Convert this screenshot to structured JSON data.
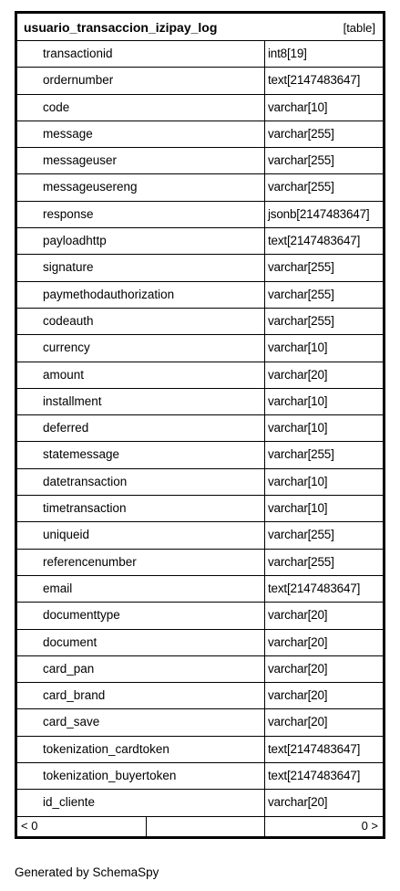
{
  "table": {
    "name": "usuario_transaccion_izipay_log",
    "kind": "[table]",
    "columns": [
      {
        "name": "transactionid",
        "type": "int8[19]"
      },
      {
        "name": "ordernumber",
        "type": "text[2147483647]"
      },
      {
        "name": "code",
        "type": "varchar[10]"
      },
      {
        "name": "message",
        "type": "varchar[255]"
      },
      {
        "name": "messageuser",
        "type": "varchar[255]"
      },
      {
        "name": "messageusereng",
        "type": "varchar[255]"
      },
      {
        "name": "response",
        "type": "jsonb[2147483647]"
      },
      {
        "name": "payloadhttp",
        "type": "text[2147483647]"
      },
      {
        "name": "signature",
        "type": "varchar[255]"
      },
      {
        "name": "paymethodauthorization",
        "type": "varchar[255]"
      },
      {
        "name": "codeauth",
        "type": "varchar[255]"
      },
      {
        "name": "currency",
        "type": "varchar[10]"
      },
      {
        "name": "amount",
        "type": "varchar[20]"
      },
      {
        "name": "installment",
        "type": "varchar[10]"
      },
      {
        "name": "deferred",
        "type": "varchar[10]"
      },
      {
        "name": "statemessage",
        "type": "varchar[255]"
      },
      {
        "name": "datetransaction",
        "type": "varchar[10]"
      },
      {
        "name": "timetransaction",
        "type": "varchar[10]"
      },
      {
        "name": "uniqueid",
        "type": "varchar[255]"
      },
      {
        "name": "referencenumber",
        "type": "varchar[255]"
      },
      {
        "name": "email",
        "type": "text[2147483647]"
      },
      {
        "name": "documenttype",
        "type": "varchar[20]"
      },
      {
        "name": "document",
        "type": "varchar[20]"
      },
      {
        "name": "card_pan",
        "type": "varchar[20]"
      },
      {
        "name": "card_brand",
        "type": "varchar[20]"
      },
      {
        "name": "card_save",
        "type": "varchar[20]"
      },
      {
        "name": "tokenization_cardtoken",
        "type": "text[2147483647]"
      },
      {
        "name": "tokenization_buyertoken",
        "type": "text[2147483647]"
      },
      {
        "name": "id_cliente",
        "type": "varchar[20]"
      }
    ],
    "footer": {
      "parents": "< 0",
      "children": "0 >"
    }
  },
  "generated_by": "Generated by SchemaSpy"
}
